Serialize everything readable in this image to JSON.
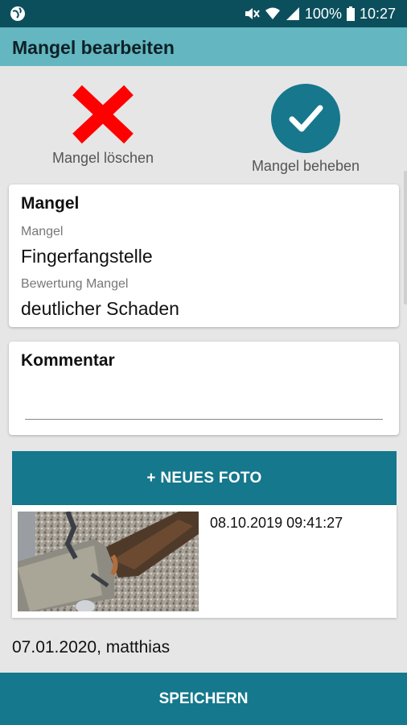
{
  "status_bar": {
    "battery": "100%",
    "time": "10:27",
    "icons": [
      "globe-icon",
      "mute-icon",
      "wifi-icon",
      "signal-icon",
      "battery-icon"
    ]
  },
  "app_bar": {
    "title": "Mangel bearbeiten"
  },
  "actions": {
    "delete_label": "Mangel löschen",
    "fix_label": "Mangel beheben"
  },
  "mangel_card": {
    "title": "Mangel",
    "field1_label": "Mangel",
    "field1_value": "Fingerfangstelle",
    "field2_label": "Bewertung Mangel",
    "field2_value": "deutlicher Schaden"
  },
  "comment_card": {
    "title": "Kommentar",
    "value": ""
  },
  "photos": {
    "add_label": "+ NEUES FOTO",
    "items": [
      {
        "timestamp": "08.10.2019 09:41:27"
      }
    ]
  },
  "footer": {
    "meta": "07.01.2020, matthias",
    "save_label": "SPEICHERN"
  },
  "colors": {
    "status_bar": "#0c4f5c",
    "app_bar": "#64b6c0",
    "primary": "#15788d",
    "delete": "#ff0000"
  }
}
